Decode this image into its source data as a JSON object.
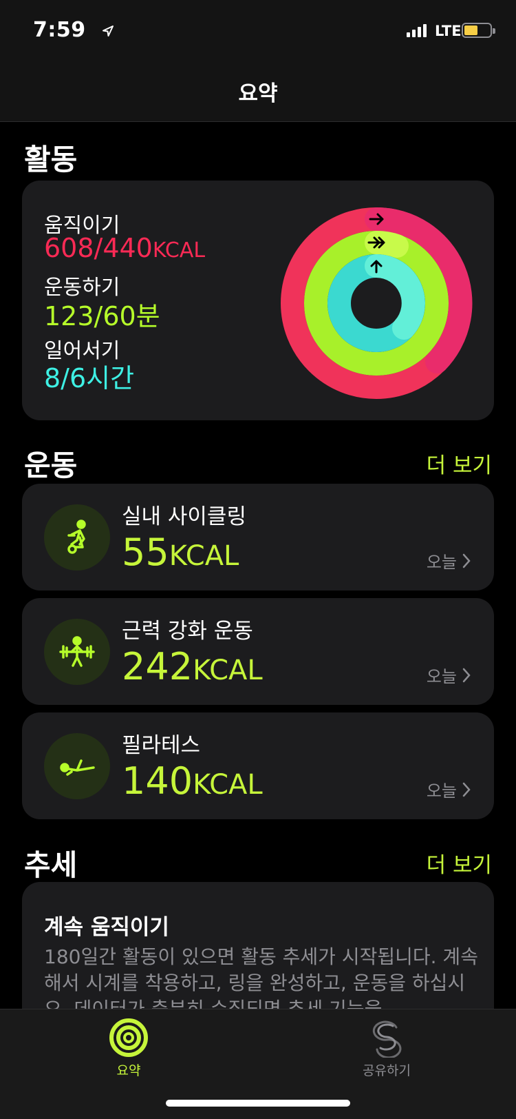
{
  "status_bar": {
    "time": "7:59",
    "network": "LTE",
    "battery_level": 0.45
  },
  "header": {
    "title": "요약"
  },
  "activity": {
    "section_title": "활동",
    "move": {
      "label": "움직이기",
      "value": "608/440",
      "unit": "KCAL",
      "progress": 1.38,
      "color": "#fa2a55"
    },
    "exercise": {
      "label": "운동하기",
      "value": "123/60분",
      "progress": 2.05,
      "color": "#b6fd2a"
    },
    "stand": {
      "label": "일어서기",
      "value": "8/6시간",
      "progress": 1.33,
      "color": "#3ef0e4"
    }
  },
  "workouts": {
    "section_title": "운동",
    "more": "더 보기",
    "items": [
      {
        "name": "실내 사이클링",
        "value": "55",
        "unit": "KCAL",
        "date": "오늘",
        "icon": "indoor-cycle-icon"
      },
      {
        "name": "근력 강화 운동",
        "value": "242",
        "unit": "KCAL",
        "date": "오늘",
        "icon": "strength-training-icon"
      },
      {
        "name": "필라테스",
        "value": "140",
        "unit": "KCAL",
        "date": "오늘",
        "icon": "pilates-icon"
      }
    ]
  },
  "trends": {
    "section_title": "추세",
    "more": "더 보기",
    "card_title": "계속 움직이기",
    "card_body": "180일간 활동이 있으면 활동 추세가 시작됩니다. 계속해서 시계를 착용하고, 링을 완성하고, 운동을 하십시오. 데이터가 충분히 수집되면 추세 기능을"
  },
  "tabs": [
    {
      "label": "요약",
      "active": true,
      "icon": "activity-rings-icon"
    },
    {
      "label": "공유하기",
      "active": false,
      "icon": "sharing-icon"
    }
  ],
  "colors": {
    "accent": "#c6f53a",
    "inactive": "#8e8e93",
    "card": "#1c1c1e"
  }
}
